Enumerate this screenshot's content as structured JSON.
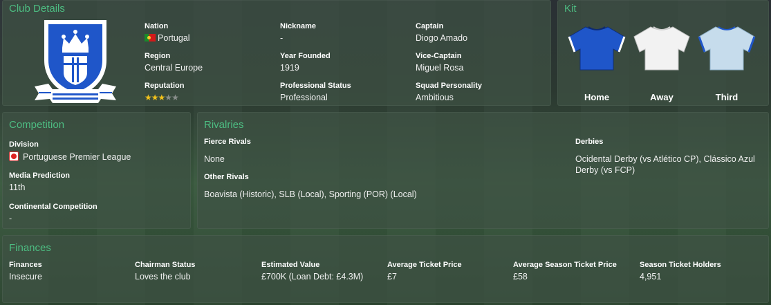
{
  "club_details": {
    "title": "Club Details",
    "nation_label": "Nation",
    "nation_value": "Portugal",
    "region_label": "Region",
    "region_value": "Central Europe",
    "reputation_label": "Reputation",
    "reputation_stars": 3,
    "reputation_max": 5,
    "nickname_label": "Nickname",
    "nickname_value": "-",
    "year_founded_label": "Year Founded",
    "year_founded_value": "1919",
    "professional_status_label": "Professional Status",
    "professional_status_value": "Professional",
    "captain_label": "Captain",
    "captain_value": "Diogo Amado",
    "vice_captain_label": "Vice-Captain",
    "vice_captain_value": "Miguel Rosa",
    "squad_personality_label": "Squad Personality",
    "squad_personality_value": "Ambitious"
  },
  "kit": {
    "title": "Kit",
    "home_label": "Home",
    "away_label": "Away",
    "third_label": "Third",
    "home_color": "#1f56c9",
    "away_color": "#f2f2f2",
    "third_color": "#c6dcec"
  },
  "competition": {
    "title": "Competition",
    "division_label": "Division",
    "division_value": "Portuguese Premier League",
    "media_prediction_label": "Media Prediction",
    "media_prediction_value": "11th",
    "continental_label": "Continental Competition",
    "continental_value": "-"
  },
  "rivalries": {
    "title": "Rivalries",
    "fierce_label": "Fierce Rivals",
    "fierce_value": "None",
    "other_label": "Other Rivals",
    "other_value": "Boavista (Historic), SLB (Local), Sporting (POR) (Local)",
    "derbies_label": "Derbies",
    "derbies_value": "Ocidental Derby (vs Atlético CP), Clássico Azul Derby (vs FCP)"
  },
  "finances": {
    "title": "Finances",
    "finances_label": "Finances",
    "finances_value": "Insecure",
    "chairman_label": "Chairman Status",
    "chairman_value": "Loves the club",
    "estimated_label": "Estimated Value",
    "estimated_value": "£700K (Loan Debt: £4.3M)",
    "ticket_label": "Average Ticket Price",
    "ticket_value": "£7",
    "season_ticket_label": "Average Season Ticket Price",
    "season_ticket_value": "£58",
    "holders_label": "Season Ticket Holders",
    "holders_value": "4,951"
  },
  "colors": {
    "accent": "#4dbd82",
    "star": "#f3c21b",
    "badge_blue": "#1f56c9"
  },
  "icons": {
    "badge": "club-crest-icon",
    "flag": "portugal-flag-icon",
    "league": "league-icon"
  }
}
